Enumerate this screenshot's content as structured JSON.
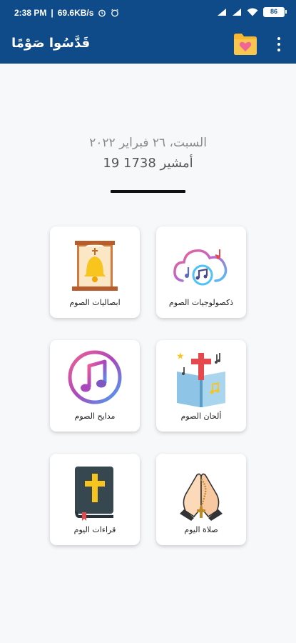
{
  "status_bar": {
    "time": "2:38 PM",
    "speed": "69.6KB/s",
    "battery": "86"
  },
  "app_bar": {
    "title": "قَدَّسُوا صَوْمًا",
    "favorites_icon": "folder-heart-icon",
    "more_icon": "more-vertical-icon"
  },
  "dates": {
    "gregorian": "السبت، ٢٦ فبراير ٢٠٢٢",
    "coptic": "19 أمشير 1738"
  },
  "tiles": [
    {
      "label": "ذكصولوجيات الصوم",
      "icon": "cloud-music-icon"
    },
    {
      "label": "ابصاليات الصوم",
      "icon": "bell-icon"
    },
    {
      "label": "ألحان الصوم",
      "icon": "hymn-book-icon"
    },
    {
      "label": "مدايح الصوم",
      "icon": "music-note-icon"
    },
    {
      "label": "صلاة اليوم",
      "icon": "praying-hands-icon"
    },
    {
      "label": "قراءات اليوم",
      "icon": "bible-icon"
    }
  ],
  "colors": {
    "app_bar": "#0f4b88",
    "bell_gold": "#f7c51e",
    "bell_frame": "#c76b34",
    "cross_red": "#e5484d"
  }
}
